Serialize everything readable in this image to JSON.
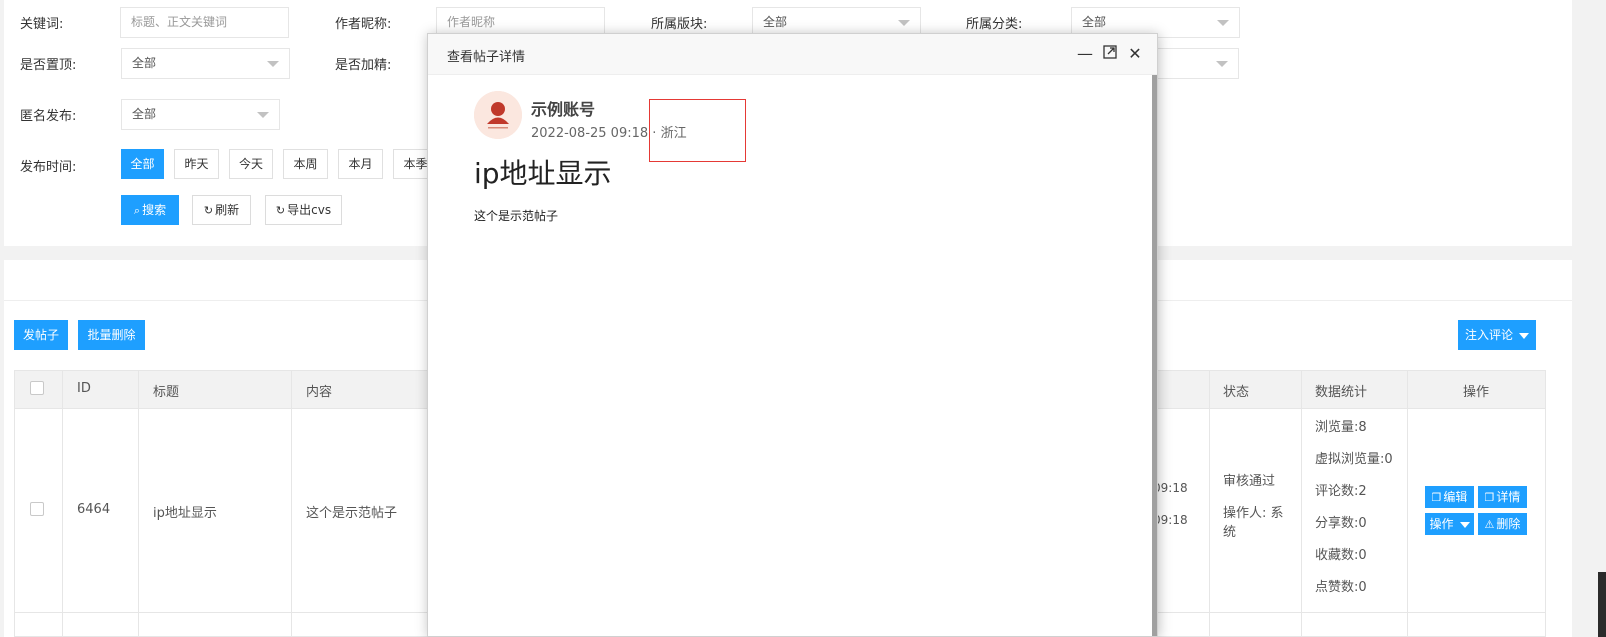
{
  "filters": {
    "keyword": {
      "label": "关键词:",
      "placeholder": "标题、正文关键词"
    },
    "author": {
      "label": "作者昵称:",
      "placeholder": "作者昵称"
    },
    "section": {
      "label": "所属版块:",
      "value": "全部"
    },
    "category": {
      "label": "所属分类:",
      "value": "全部"
    },
    "pinned": {
      "label": "是否置顶:",
      "value": "全部"
    },
    "featured": {
      "label": "是否加精:"
    },
    "anonymous": {
      "label": "匿名发布:",
      "value": "全部"
    },
    "time": {
      "label": "发布时间:",
      "options": [
        "全部",
        "昨天",
        "今天",
        "本周",
        "本月",
        "本季"
      ],
      "selected": "全部"
    },
    "search_label": "搜索",
    "refresh_label": "刷新",
    "export_label": "导出cvs"
  },
  "toolbar": {
    "post_label": "发帖子",
    "batch_delete_label": "批量删除",
    "inject_label": "注入评论"
  },
  "table": {
    "headers": [
      "ID",
      "标题",
      "内容",
      "状态",
      "数据统计",
      "操作"
    ],
    "rows": [
      {
        "id": "6464",
        "title": "ip地址显示",
        "content": "这个是示范帖子",
        "time1": "09:18",
        "time2": "09:18",
        "status": "审核通过",
        "operator_line1": "操作人: 系",
        "operator_line2": "统",
        "stats": [
          "浏览量:8",
          "虚拟浏览量:0",
          "评论数:2",
          "分享数:0",
          "收藏数:0",
          "点赞数:0"
        ],
        "actions": {
          "edit": "编辑",
          "detail": "详情",
          "ops": "操作",
          "delete": "删除"
        }
      }
    ]
  },
  "modal": {
    "title": "查看帖子详情",
    "author": "示例账号",
    "datetime": "2022-08-25 09:18",
    "separator": " · ",
    "location": "浙江",
    "post_title": "ip地址显示",
    "post_body": "这个是示范帖子"
  },
  "colors": {
    "primary": "#1e9fff",
    "highlight": "#e53935"
  }
}
